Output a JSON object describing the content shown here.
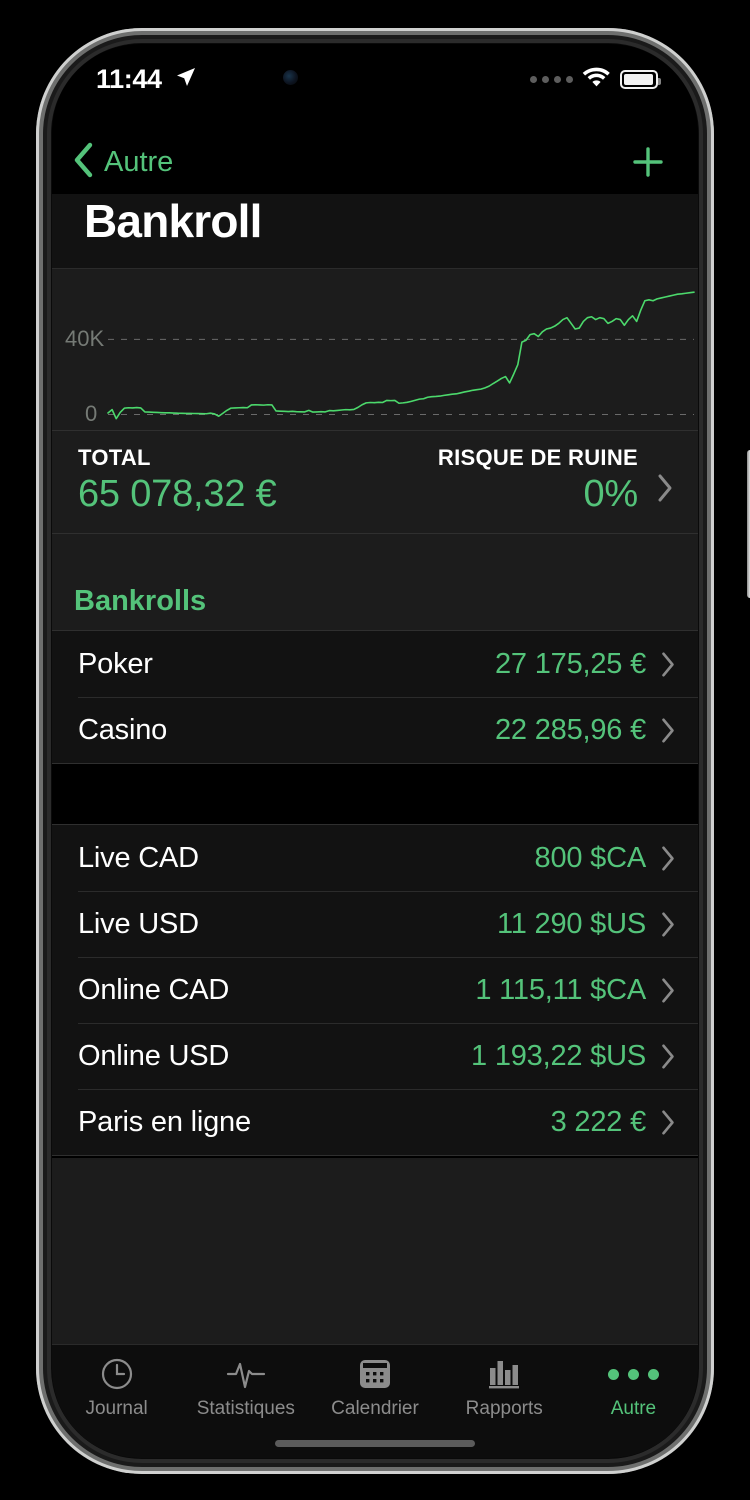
{
  "status_bar": {
    "time": "11:44",
    "location_icon": "location-arrow-icon",
    "signal_icon": "cellular-dots-icon",
    "wifi_icon": "wifi-icon",
    "battery_icon": "battery-full-icon"
  },
  "nav": {
    "back_label": "Autre",
    "back_icon": "chevron-left-icon",
    "add_icon": "plus-icon"
  },
  "header": {
    "title": "Bankroll"
  },
  "chart_data": {
    "type": "line",
    "title": "Bankroll",
    "xlabel": "",
    "ylabel": "",
    "ylim": [
      -4000,
      70000
    ],
    "yticks": [
      0,
      40000
    ],
    "ytick_labels": [
      "0",
      "40K"
    ],
    "grid": true,
    "legend": "none",
    "series": [
      {
        "name": "Bankroll",
        "color": "#4cd96c",
        "values": [
          800,
          2600,
          -2200,
          1200,
          3400,
          3600,
          3500,
          3700,
          3500,
          1400,
          1300,
          1200,
          1100,
          1000,
          900,
          900,
          800,
          700,
          650,
          600,
          600,
          550,
          500,
          450,
          420,
          700,
          300,
          -900,
          600,
          2200,
          3400,
          3500,
          3600,
          3700,
          3600,
          5100,
          5200,
          5100,
          5000,
          5200,
          5100,
          1900,
          1800,
          1700,
          1600,
          1700,
          1500,
          1450,
          1400,
          2200,
          1300,
          1400,
          1500,
          1400,
          2100,
          2000,
          2200,
          2400,
          2600,
          2500,
          2700,
          3800,
          5200,
          6200,
          6400,
          6300,
          6500,
          6400,
          7500,
          7400,
          7500,
          6000,
          6200,
          6500,
          7000,
          7600,
          8200,
          8400,
          9200,
          9500,
          9600,
          9800,
          10200,
          10500,
          10800,
          11000,
          11500,
          12000,
          12400,
          12900,
          13200,
          13500,
          14200,
          15100,
          16500,
          17800,
          19200,
          20200,
          16800,
          21500,
          26500,
          38500,
          39500,
          42500,
          43000,
          41500,
          44000,
          45500,
          46000,
          47000,
          48500,
          50500,
          51500,
          48500,
          45500,
          46000,
          49500,
          51500,
          52000,
          50500,
          51500,
          51000,
          48500,
          49500,
          51000,
          50500,
          47500,
          50500,
          52500,
          49500,
          55500,
          60500,
          61000,
          60500,
          61500,
          62000,
          62500,
          63000,
          63500,
          64000,
          64200,
          64500,
          64800,
          65078
        ]
      }
    ]
  },
  "summary": {
    "total_label": "TOTAL",
    "total_value": "65 078,32 €",
    "risk_label": "RISQUE DE RUINE",
    "risk_value": "0%",
    "chevron_icon": "chevron-right-icon"
  },
  "section": {
    "title": "Bankrolls"
  },
  "bankrolls": [
    {
      "label": "Poker",
      "value": "27 175,25 €"
    },
    {
      "label": "Casino",
      "value": "22 285,96 €"
    }
  ],
  "accounts": [
    {
      "label": "Live CAD",
      "value": "800 $CA"
    },
    {
      "label": "Live USD",
      "value": "11 290 $US"
    },
    {
      "label": "Online CAD",
      "value": "1 115,11 $CA"
    },
    {
      "label": "Online USD",
      "value": "1 193,22 $US"
    },
    {
      "label": "Paris en ligne",
      "value": "3 222 €"
    }
  ],
  "tabs": [
    {
      "label": "Journal",
      "icon": "clock-icon",
      "active": false
    },
    {
      "label": "Statistiques",
      "icon": "pulse-icon",
      "active": false
    },
    {
      "label": "Calendrier",
      "icon": "calendar-icon",
      "active": false
    },
    {
      "label": "Rapports",
      "icon": "bar-chart-icon",
      "active": false
    },
    {
      "label": "Autre",
      "icon": "ellipsis-icon",
      "active": true
    }
  ],
  "colors": {
    "accent_green": "#54c37a",
    "chart_green": "#4cd96c",
    "background": "#121212",
    "card": "#1c1c1c"
  }
}
